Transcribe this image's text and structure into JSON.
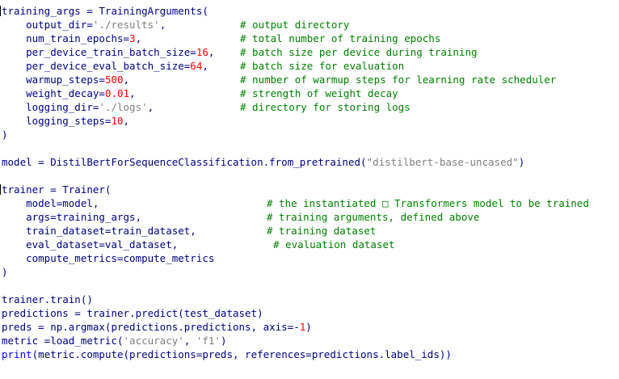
{
  "editor": {
    "lines": [
      {
        "parts": [
          {
            "t": "training_args = TrainingArguments("
          }
        ],
        "caret": true
      },
      {
        "parts": [
          {
            "t": "    output_dir="
          },
          {
            "t": "'./results'",
            "c": "str"
          },
          {
            "t": ","
          }
        ],
        "comment": "# output directory",
        "cpos": 297
      },
      {
        "parts": [
          {
            "t": "    num_train_epochs="
          },
          {
            "t": "3",
            "c": "num"
          },
          {
            "t": ","
          }
        ],
        "comment": "# total number of training epochs",
        "cpos": 297
      },
      {
        "parts": [
          {
            "t": "    per_device_train_batch_size="
          },
          {
            "t": "16",
            "c": "num"
          },
          {
            "t": ","
          }
        ],
        "comment": "# batch size per device during training",
        "cpos": 297
      },
      {
        "parts": [
          {
            "t": "    per_device_eval_batch_size="
          },
          {
            "t": "64",
            "c": "num"
          },
          {
            "t": ","
          }
        ],
        "comment": "# batch size for evaluation",
        "cpos": 297
      },
      {
        "parts": [
          {
            "t": "    warmup_steps="
          },
          {
            "t": "500",
            "c": "num"
          },
          {
            "t": ","
          }
        ],
        "comment": "# number of warmup steps for learning rate scheduler",
        "cpos": 297
      },
      {
        "parts": [
          {
            "t": "    weight_decay="
          },
          {
            "t": "0.01",
            "c": "num"
          },
          {
            "t": ","
          }
        ],
        "comment": "# strength of weight decay",
        "cpos": 297
      },
      {
        "parts": [
          {
            "t": "    logging_dir="
          },
          {
            "t": "'./logs'",
            "c": "str"
          },
          {
            "t": ","
          }
        ],
        "comment": "# directory for storing logs",
        "cpos": 297
      },
      {
        "parts": [
          {
            "t": "    logging_steps="
          },
          {
            "t": "10",
            "c": "num"
          },
          {
            "t": ","
          }
        ]
      },
      {
        "parts": [
          {
            "t": ")"
          }
        ]
      },
      {
        "parts": [
          {
            "t": ""
          }
        ]
      },
      {
        "parts": [
          {
            "t": "model = DistilBertForSequenceClassification.from_pretrained("
          },
          {
            "t": "\"distilbert-base-uncased\"",
            "c": "str"
          },
          {
            "t": ")"
          }
        ]
      },
      {
        "parts": [
          {
            "t": ""
          }
        ]
      },
      {
        "parts": [
          {
            "t": "trainer = Trainer("
          }
        ],
        "caret": true
      },
      {
        "parts": [
          {
            "t": "    model=model,"
          }
        ],
        "comment": "# the instantiated □ Transformers model to be trained",
        "cpos": 330
      },
      {
        "parts": [
          {
            "t": "    args=training_args,"
          }
        ],
        "comment": "# training arguments, defined above",
        "cpos": 330
      },
      {
        "parts": [
          {
            "t": "    train_dataset=train_dataset,"
          }
        ],
        "comment": "# training dataset",
        "cpos": 330
      },
      {
        "parts": [
          {
            "t": "    eval_dataset=val_dataset,"
          }
        ],
        "comment": "# evaluation dataset",
        "cpos": 338
      },
      {
        "parts": [
          {
            "t": "    compute_metrics=compute_metrics"
          }
        ]
      },
      {
        "parts": [
          {
            "t": ")"
          }
        ]
      },
      {
        "parts": [
          {
            "t": ""
          }
        ]
      },
      {
        "parts": [
          {
            "t": "trainer.train()"
          }
        ]
      },
      {
        "parts": [
          {
            "t": "predictions = trainer.predict(test_dataset)"
          }
        ]
      },
      {
        "parts": [
          {
            "t": "preds = np.argmax(predictions.predictions, axis=-"
          },
          {
            "t": "1",
            "c": "num"
          },
          {
            "t": ")"
          }
        ]
      },
      {
        "parts": [
          {
            "t": "metric =load_metric("
          },
          {
            "t": "'accuracy'",
            "c": "str"
          },
          {
            "t": ", "
          },
          {
            "t": "'f1'",
            "c": "str"
          },
          {
            "t": ")"
          }
        ]
      },
      {
        "parts": [
          {
            "t": "print",
            "c": "kw"
          },
          {
            "t": "(metric.compute(predictions=preds, references=predictions.label_ids))"
          }
        ]
      }
    ]
  }
}
